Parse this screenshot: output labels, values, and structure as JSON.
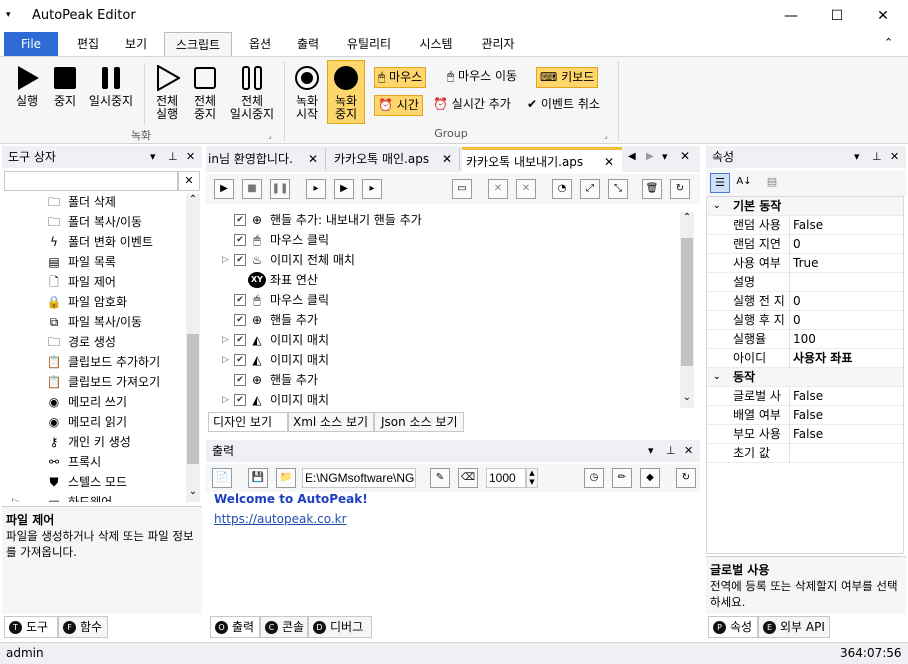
{
  "window": {
    "title": "AutoPeak Editor",
    "minimize": "—",
    "maximize": "☐",
    "close": "✕",
    "menu_glyph": "▾"
  },
  "ribbon_tabs": [
    {
      "label": "File"
    },
    {
      "label": "편집"
    },
    {
      "label": "보기"
    },
    {
      "label": "스크립트"
    },
    {
      "label": "옵션"
    },
    {
      "label": "출력"
    },
    {
      "label": "유틸리티"
    },
    {
      "label": "시스템"
    },
    {
      "label": "관리자"
    }
  ],
  "ribbon": {
    "run": "실행",
    "stop": "중지",
    "pause": "일시중지",
    "run_all_1": "전체",
    "run_all_2": "실행",
    "stop_all_1": "전체",
    "stop_all_2": "중지",
    "pause_all_1": "전체",
    "pause_all_2": "일시중지",
    "group_record": "녹화",
    "rec_start_1": "녹화",
    "rec_start_2": "시작",
    "rec_stop_1": "녹화",
    "rec_stop_2": "중지",
    "mouse": "마우스",
    "mouse_move": "마우스 이동",
    "keyboard": "키보드",
    "time": "시간",
    "realtime_add": "실시간 추가",
    "event_cancel": "이벤트 취소",
    "group_group": "Group",
    "collapse": "⌃"
  },
  "toolbox": {
    "title": "도구 상자",
    "search_placeholder": "",
    "clear": "✕",
    "items": [
      {
        "label": "폴더 삭제",
        "icon": "folder-delete-icon"
      },
      {
        "label": "폴더 복사/이동",
        "icon": "folder-copy-icon"
      },
      {
        "label": "폴더 변화 이벤트",
        "icon": "lightning-icon"
      },
      {
        "label": "파일 목록",
        "icon": "list-icon"
      },
      {
        "label": "파일 제어",
        "icon": "file-icon"
      },
      {
        "label": "파일 암호화",
        "icon": "lock-icon"
      },
      {
        "label": "파일 복사/이동",
        "icon": "file-copy-icon"
      },
      {
        "label": "경로 생성",
        "icon": "folder-create-icon"
      },
      {
        "label": "클립보드 추가하기",
        "icon": "clipboard-add-icon"
      },
      {
        "label": "클립보드 가져오기",
        "icon": "clipboard-get-icon"
      },
      {
        "label": "메모리 쓰기",
        "icon": "memory-write-icon"
      },
      {
        "label": "메모리 읽기",
        "icon": "memory-read-icon"
      },
      {
        "label": "개인 키 생성",
        "icon": "key-icon"
      },
      {
        "label": "프록시",
        "icon": "proxy-icon"
      },
      {
        "label": "스텔스 모드",
        "icon": "shield-icon"
      },
      {
        "label": "하드웨어",
        "icon": "hardware-icon"
      }
    ],
    "desc_title": "파일 제어",
    "desc_text": "파일을 생성하거나 삭제 또는 파일 정보를 가져옵니다.",
    "tabs": [
      {
        "letter": "T",
        "label": "도구"
      },
      {
        "letter": "F",
        "label": "함수"
      }
    ]
  },
  "doc_tabs": [
    {
      "label": "in님 환영합니다."
    },
    {
      "label": "카카오톡 매인.aps"
    },
    {
      "label": "카카오톡 내보내기.aps"
    }
  ],
  "script_lines": [
    {
      "label": "핸들 추가: 내보내기 핸들 추가",
      "expand": false,
      "icon": "crosshair-icon"
    },
    {
      "label": "마우스 클릭",
      "expand": false,
      "icon": "mouse-icon"
    },
    {
      "label": "이미지 전체 매치",
      "expand": true,
      "icon": "images-icon"
    },
    {
      "label": "좌표 연산",
      "expand": false,
      "icon": "xy-icon",
      "nochk": true
    },
    {
      "label": "마우스 클릭",
      "expand": false,
      "icon": "mouse-icon"
    },
    {
      "label": "핸들 추가",
      "expand": false,
      "icon": "crosshair-icon"
    },
    {
      "label": "이미지 매치",
      "expand": true,
      "icon": "image-icon"
    },
    {
      "label": "이미지 매치",
      "expand": true,
      "icon": "image-icon"
    },
    {
      "label": "핸들 추가",
      "expand": false,
      "icon": "crosshair-icon"
    },
    {
      "label": "이미지 매치",
      "expand": true,
      "icon": "image-icon"
    }
  ],
  "view_tabs": [
    {
      "label": "디자인 보기"
    },
    {
      "label": "Xml 소스 보기"
    },
    {
      "label": "Json 소스 보기"
    }
  ],
  "output": {
    "title": "출력",
    "path": "E:\\NGMsoftware\\NG",
    "count": "1000",
    "welcome": "Welcome to AutoPeak!",
    "link": "https://autopeak.co.kr",
    "tabs": [
      {
        "letter": "O",
        "label": "출력"
      },
      {
        "letter": "C",
        "label": "콘솔"
      },
      {
        "letter": "D",
        "label": "디버그"
      }
    ]
  },
  "properties": {
    "title": "속성",
    "categories": [
      {
        "name": "기본 동작",
        "rows": [
          {
            "k": "랜덤 사용",
            "v": "False"
          },
          {
            "k": "랜덤 지연",
            "v": "0"
          },
          {
            "k": "사용 여부",
            "v": "True"
          },
          {
            "k": "설명",
            "v": ""
          },
          {
            "k": "실행 전 지",
            "v": "0"
          },
          {
            "k": "실행 후 지",
            "v": "0"
          },
          {
            "k": "실행율",
            "v": "100"
          },
          {
            "k": "아이디",
            "v": "사용자 좌표"
          }
        ]
      },
      {
        "name": "동작",
        "rows": [
          {
            "k": "글로벌 사",
            "v": "False"
          },
          {
            "k": "배열 여부",
            "v": "False"
          },
          {
            "k": "부모 사용",
            "v": "False"
          },
          {
            "k": "초기 값",
            "v": ""
          }
        ]
      }
    ],
    "desc_title": "글로벌 사용",
    "desc_text": "전역에 등록 또는 삭제할지 여부를 선택하세요.",
    "tabs": [
      {
        "letter": "P",
        "label": "속성"
      },
      {
        "letter": "E",
        "label": "외부 API"
      }
    ]
  },
  "status": {
    "user": "admin",
    "time": "364:07:56"
  }
}
